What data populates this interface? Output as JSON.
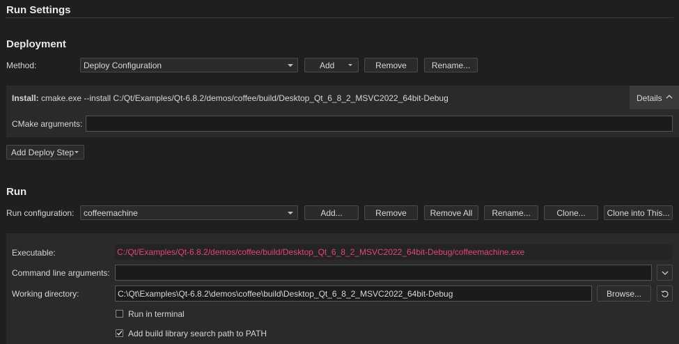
{
  "header": {
    "title": "Run Settings"
  },
  "deployment": {
    "title": "Deployment",
    "method_label": "Method:",
    "method_value": "Deploy Configuration",
    "add_label": "Add",
    "remove_label": "Remove",
    "rename_label": "Rename...",
    "install_label": "Install:",
    "install_text": "cmake.exe --install C:/Qt/Examples/Qt-6.8.2/demos/coffee/build/Desktop_Qt_6_8_2_MSVC2022_64bit-Debug",
    "details_label": "Details",
    "cmake_args_label": "CMake arguments:",
    "cmake_args_value": "",
    "add_step_label": "Add Deploy Step"
  },
  "run": {
    "title": "Run",
    "config_label": "Run configuration:",
    "config_value": "coffeemachine",
    "add_label": "Add...",
    "remove_label": "Remove",
    "remove_all_label": "Remove All",
    "rename_label": "Rename...",
    "clone_label": "Clone...",
    "clone_into_label": "Clone into This...",
    "executable_label": "Executable:",
    "executable_value": "C:/Qt/Examples/Qt-6.8.2/demos/coffee/build/Desktop_Qt_6_8_2_MSVC2022_64bit-Debug/coffeemachine.exe",
    "executable_color": "#e0447a",
    "cmd_args_label": "Command line arguments:",
    "cmd_args_value": "",
    "workdir_label": "Working directory:",
    "workdir_value": "C:\\Qt\\Examples\\Qt-6.8.2\\demos\\coffee\\build\\Desktop_Qt_6_8_2_MSVC2022_64bit-Debug",
    "browse_label": "Browse...",
    "run_in_terminal_label": "Run in terminal",
    "run_in_terminal_checked": false,
    "add_lib_path_label": "Add build library search path to PATH",
    "add_lib_path_checked": true
  }
}
